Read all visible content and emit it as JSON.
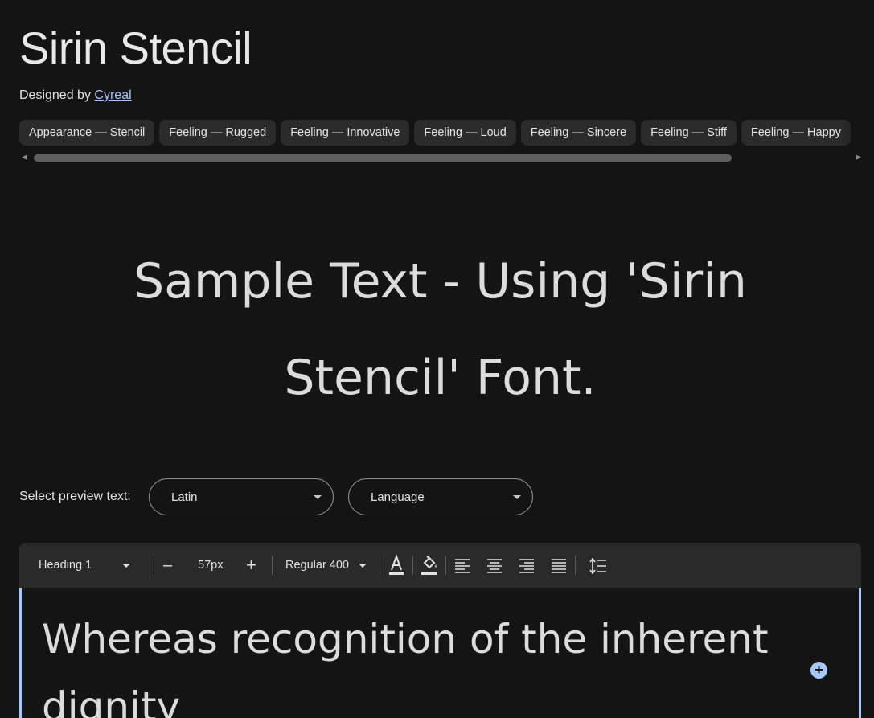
{
  "font": {
    "title": "Sirin Stencil",
    "designed_by_label": "Designed by",
    "designer": "Cyreal"
  },
  "tags": [
    "Appearance — Stencil",
    "Feeling — Rugged",
    "Feeling — Innovative",
    "Feeling — Loud",
    "Feeling — Sincere",
    "Feeling — Stiff",
    "Feeling — Happy"
  ],
  "sample_text": "Sample Text - Using 'Sirin Stencil' Font.",
  "preview": {
    "label": "Select preview text:",
    "script_select": "Latin",
    "language_select": "Language"
  },
  "toolbar": {
    "style_select": "Heading 1",
    "decrease": "–",
    "size": "57px",
    "increase": "+",
    "weight_select": "Regular 400"
  },
  "editor": {
    "text": "Whereas recognition of the inherent dignity"
  },
  "colors": {
    "background": "#141414",
    "accent": "#a8c7fa",
    "chip": "#2b2b2b",
    "toolbar": "#2a2a2a"
  }
}
